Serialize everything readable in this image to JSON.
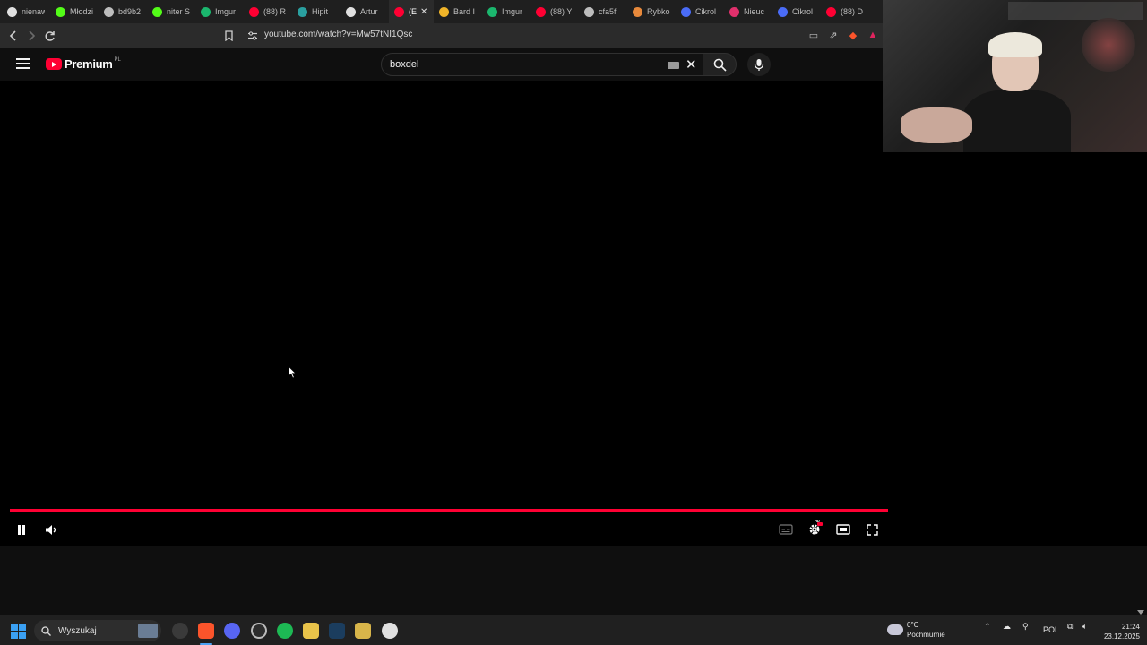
{
  "browser": {
    "tabs": [
      {
        "label": "nienaw",
        "color": "#e0e0e0"
      },
      {
        "label": "Młodzi",
        "color": "#53fc18"
      },
      {
        "label": "bd9b2",
        "color": "#bdbdbd"
      },
      {
        "label": "niter S",
        "color": "#53fc18"
      },
      {
        "label": "Imgur",
        "color": "#1bb76e"
      },
      {
        "label": "(88) R",
        "color": "#ff0033"
      },
      {
        "label": "Hipit",
        "color": "#2aa0a0"
      },
      {
        "label": "Artur",
        "color": "#e0e0e0"
      },
      {
        "label": "(E",
        "color": "#ff0033",
        "active": true
      },
      {
        "label": "Bard I",
        "color": "#f0b429"
      },
      {
        "label": "Imgur",
        "color": "#1bb76e"
      },
      {
        "label": "(88) Y",
        "color": "#ff0033"
      },
      {
        "label": "cfa5f",
        "color": "#bdbdbd"
      },
      {
        "label": "Rybko",
        "color": "#e8893b"
      },
      {
        "label": "Cikrol",
        "color": "#4a6cf7"
      },
      {
        "label": "Nieuc",
        "color": "#e1306c"
      },
      {
        "label": "Cikrol",
        "color": "#4a6cf7"
      },
      {
        "label": "(88) D",
        "color": "#ff0033"
      }
    ],
    "close_glyph": "✕",
    "url": "youtube.com/watch?v=Mw57tNI1Qsc"
  },
  "youtube": {
    "brand": "Premium",
    "region": "PL",
    "search_query": "boxdel"
  },
  "player": {
    "progress": 1.0,
    "hd_badge": "HD"
  },
  "taskbar": {
    "search_label": "Wyszukaj",
    "weather_temp": "0°C",
    "weather_desc": "Pochmurnie",
    "language": "POL",
    "time": "21:24",
    "date": "23.12.2025"
  },
  "colors": {
    "accent_red": "#ff0033"
  }
}
